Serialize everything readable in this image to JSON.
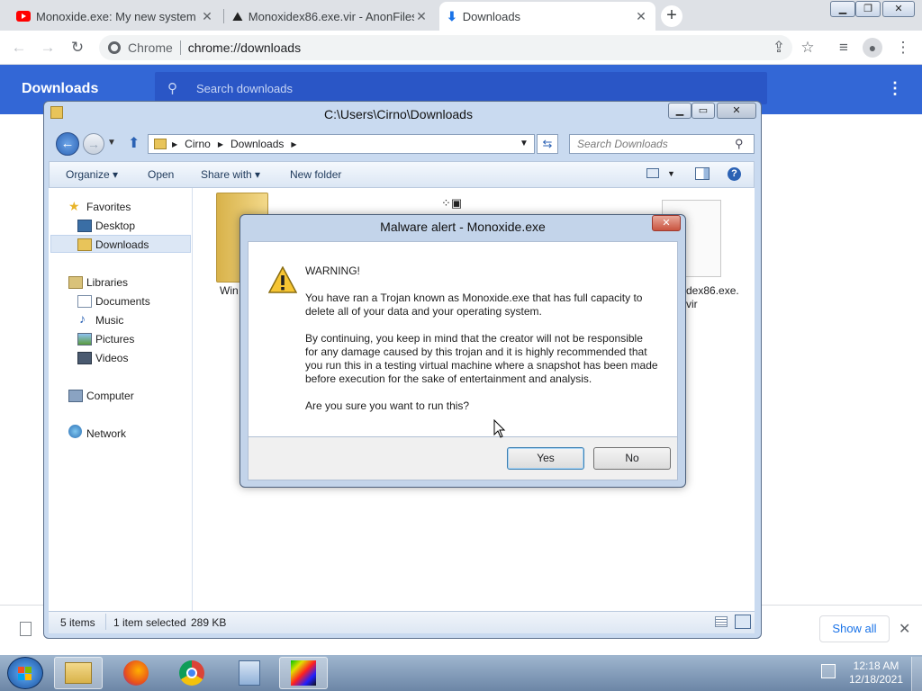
{
  "chrome": {
    "tabs": [
      {
        "title": "Monoxide.exe: My new system d",
        "icon": "youtube-icon"
      },
      {
        "title": "Monoxidex86.exe.vir - AnonFiles",
        "icon": "anonfiles-icon"
      },
      {
        "title": "Downloads",
        "icon": "download-icon"
      }
    ],
    "close_glyph": "✕",
    "site_label": "Chrome",
    "url": "chrome://downloads"
  },
  "downloads_page": {
    "title": "Downloads",
    "search_placeholder": "Search downloads",
    "show_all_label": "Show all"
  },
  "explorer": {
    "title": "C:\\Users\\Cirno\\Downloads",
    "breadcrumb": [
      "Cirno",
      "Downloads"
    ],
    "search_placeholder": "Search Downloads",
    "commands": {
      "organize": "Organize",
      "open": "Open",
      "share_with": "Share with",
      "new_folder": "New folder"
    },
    "nav": {
      "favorites": "Favorites",
      "desktop": "Desktop",
      "downloads": "Downloads",
      "libraries": "Libraries",
      "documents": "Documents",
      "music": "Music",
      "pictures": "Pictures",
      "videos": "Videos",
      "computer": "Computer",
      "network": "Network"
    },
    "file_labels": {
      "left_partial": "Win",
      "right_partial_1": "dex86.exe.",
      "right_partial_2": "vir"
    },
    "status": {
      "items": "5 items",
      "selected": "1 item selected",
      "size": "289 KB"
    }
  },
  "dialog": {
    "title": "Malware alert - Monoxide.exe",
    "heading": "WARNING!",
    "paragraph1": "You have ran a Trojan known as Monoxide.exe that has full capacity to delete all of your data and your operating system.",
    "paragraph2": "By continuing, you keep in mind that the creator will not be responsible for any damage caused by this trojan and it is highly recommended that you run this in a testing virtual machine where a snapshot has been made before execution for the sake of entertainment and analysis.",
    "question": "Are you sure you want to run this?",
    "yes_label": "Yes",
    "no_label": "No",
    "close_glyph": "✕"
  },
  "taskbar": {
    "time": "12:18 AM",
    "date": "12/18/2021",
    "apps": [
      "windows-explorer-icon",
      "firefox-icon",
      "chrome-icon",
      "installer-icon",
      "monoxide-icon"
    ]
  },
  "colors": {
    "chrome_blue": "#3367d6",
    "link_blue": "#1a73e8",
    "win7_frame": "#c9daf0"
  }
}
